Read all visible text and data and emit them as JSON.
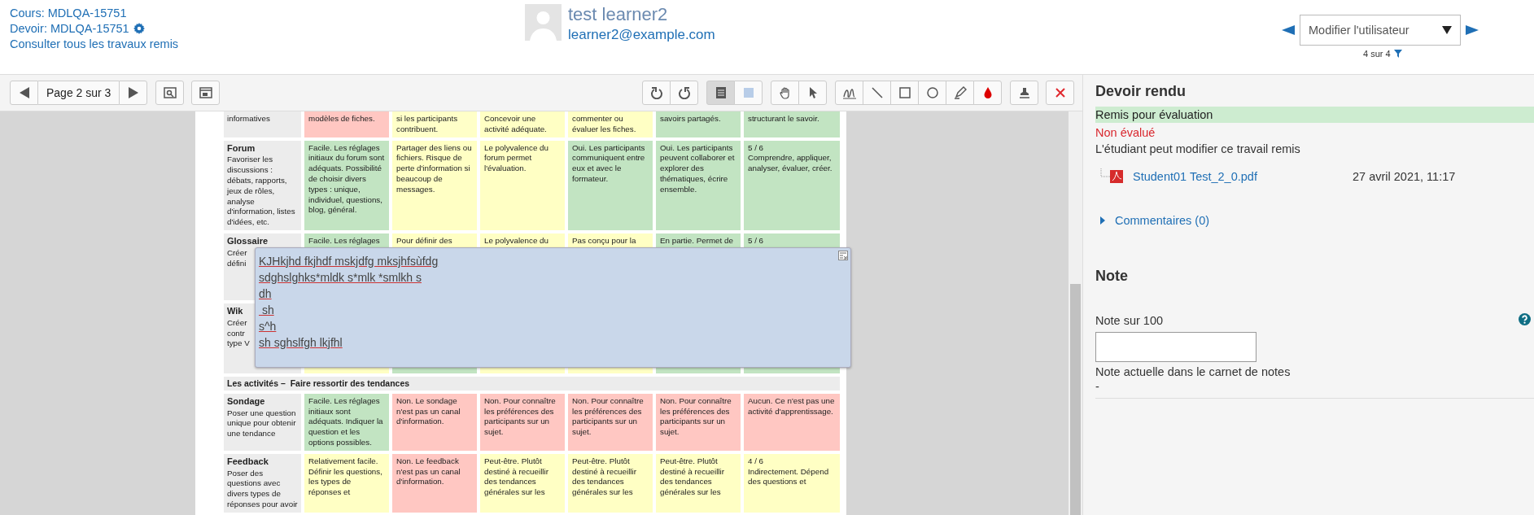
{
  "header": {
    "course_link": "Cours: MDLQA-15751",
    "assignment_link": "Devoir: MDLQA-15751",
    "all_submissions_link": "Consulter tous les travaux remis",
    "user": {
      "name": "test learner2",
      "email": "learner2@example.com"
    },
    "user_select": {
      "value": "Modifier l'utilisateur"
    },
    "user_count": "4 sur 4"
  },
  "toolbar": {
    "page_label": "Page 2 sur 3",
    "view_buttons": [
      {
        "selected": true
      },
      {
        "selected": false
      }
    ]
  },
  "document": {
    "rows": [
      {
        "kind": "activity",
        "title": "",
        "description": "informatives",
        "cells": [
          {
            "text": "modèles de fiches.",
            "color": "#ffc7c2"
          },
          {
            "text": "si les participants contribuent.",
            "color": "#ffffc8"
          },
          {
            "text": "Concevoir une activité adéquate.",
            "color": "#ffffc4"
          },
          {
            "text": "commenter ou évaluer les fiches.",
            "color": "#ffffc4"
          },
          {
            "text": "savoirs partagés.",
            "color": "#c2e4c2"
          },
          {
            "text": "structurant le savoir.",
            "color": "#c2e4c2"
          }
        ]
      },
      {
        "kind": "activity",
        "title": "Forum",
        "description": "Favoriser les discussions : débats, rapports, jeux de rôles, analyse d'information, listes d'idées, etc.",
        "cells": [
          {
            "text": "Facile. Les réglages initiaux du forum sont adéquats. Possibilité de choisir divers types : unique, individuel, questions, blog, général.",
            "color": "#c2e4c2"
          },
          {
            "text": "Partager des liens ou fichiers. Risque de perte d'information si beaucoup de messages.",
            "color": "#ffffc4"
          },
          {
            "text": "Le polyvalence du forum permet l'évaluation.",
            "color": "#ffffc4"
          },
          {
            "text": "Oui. Les participants communiquent entre eux et avec le formateur.",
            "color": "#c2e4c2"
          },
          {
            "text": "Oui. Les participants peuvent collaborer et explorer des thématiques, écrire ensemble.",
            "color": "#c2e4c2"
          },
          {
            "text": "5 / 6\nComprendre, appliquer, analyser, évaluer, créer.",
            "color": "#c2e4c2"
          }
        ]
      },
      {
        "kind": "activity",
        "title": "Glossaire",
        "description": "Créer\ndéfini",
        "cells": [
          {
            "text": "Facile. Les réglages",
            "color": "#c2e4c2"
          },
          {
            "text": "Pour définir des",
            "color": "#ffffc4"
          },
          {
            "text": "Le polyvalence du",
            "color": "#ffffc4"
          },
          {
            "text": "Pas conçu pour la",
            "color": "#ffffc4"
          },
          {
            "text": "En partie. Permet de",
            "color": "#c2e4c2"
          },
          {
            "text": "5 / 6",
            "color": "#c2e4c2"
          }
        ],
        "comment": {
          "lines": [
            "KJHkjhd fkjhdf mskjdfg mksjhfsùfdg",
            "sdghslghks*mldk s*mlk *smlkh s",
            "dh",
            " sh",
            "s^h",
            "sh sghslfgh lkjfhl"
          ]
        }
      },
      {
        "kind": "activity",
        "title": "Wik",
        "description": "Créer\ncontr\ntype V",
        "cells": [
          {
            "text": "",
            "color": "#ffffc4"
          },
          {
            "text": "",
            "color": "#c2e4c2"
          },
          {
            "text": "",
            "color": "#ffffc4"
          },
          {
            "text": "",
            "color": "#ffffc4"
          },
          {
            "text": "",
            "color": "#c2e4c2"
          },
          {
            "text": "",
            "color": "#c2e4c2"
          }
        ]
      },
      {
        "kind": "section",
        "title": "Les activités –  Faire ressortir des tendances"
      },
      {
        "kind": "activity",
        "title": "Sondage",
        "description": "Poser une question unique pour obtenir une tendance",
        "cells": [
          {
            "text": "Facile. Les réglages initiaux sont adéquats. Indiquer la question et les options possibles.",
            "color": "#c2e4c2"
          },
          {
            "text": "Non. Le sondage n'est pas un canal d'information.",
            "color": "#ffc7c2"
          },
          {
            "text": "Non. Pour connaître les préférences des participants sur un sujet.",
            "color": "#ffc7c2"
          },
          {
            "text": "Non. Pour connaître les préférences des participants sur un sujet.",
            "color": "#ffc7c2"
          },
          {
            "text": "Non. Pour connaître les préférences des participants sur un sujet.",
            "color": "#ffc7c2"
          },
          {
            "text": "Aucun. Ce n'est pas une activité d'apprentissage.",
            "color": "#ffc7c2"
          }
        ]
      },
      {
        "kind": "activity",
        "title": "Feedback",
        "description": "Poser des questions avec divers types de réponses pour avoir",
        "cells": [
          {
            "text": "Relativement facile. Définir les questions, les types de réponses et",
            "color": "#ffffc4"
          },
          {
            "text": "Non. Le feedback n'est pas un canal d'information.",
            "color": "#ffc7c2"
          },
          {
            "text": "Peut-être. Plutôt destiné à recueillir des tendances générales sur les",
            "color": "#ffffc4"
          },
          {
            "text": "Peut-être. Plutôt destiné à recueillir des tendances générales sur les",
            "color": "#ffffc4"
          },
          {
            "text": "Peut-être. Plutôt destiné à recueillir des tendances générales sur les",
            "color": "#ffffc4"
          },
          {
            "text": "4 / 6\nIndirectement. Dépend des questions et",
            "color": "#ffffc4"
          }
        ]
      }
    ]
  },
  "panel": {
    "title": "Devoir rendu",
    "status": "Remis pour évaluation",
    "grading_status": "Non évalué",
    "edit_note": "L'étudiant peut modifier ce travail remis",
    "file": {
      "name": "Student01 Test_2_0.pdf",
      "date": "27 avril 2021, 11:17"
    },
    "comments_link": "Commentaires (0)",
    "grade_title": "Note",
    "grade_label": "Note sur 100",
    "current_grade_label": "Note actuelle dans le carnet de notes",
    "current_grade": "-"
  }
}
